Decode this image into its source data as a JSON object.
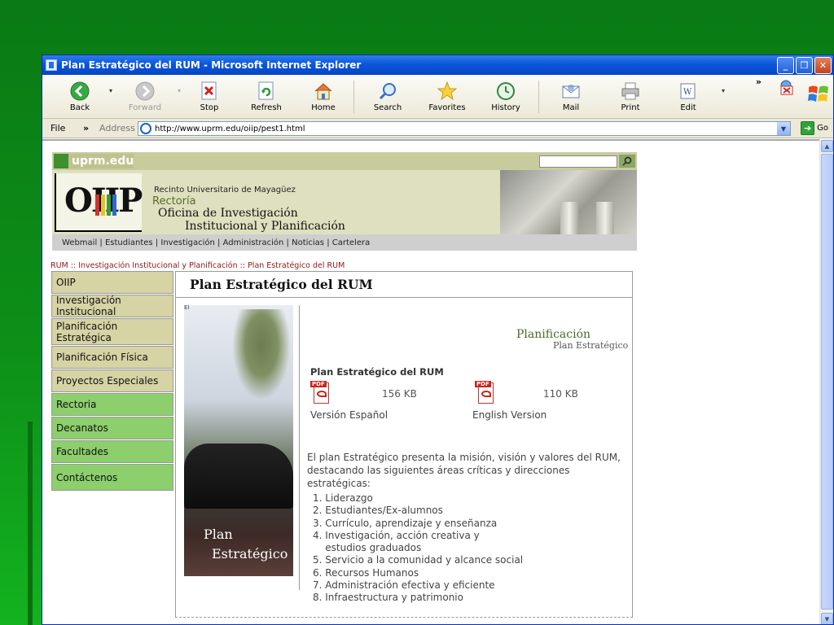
{
  "window": {
    "title": "Plan Estratégico del RUM - Microsoft Internet Explorer",
    "buttons": {
      "minimize": "_",
      "maximize": "❐",
      "close": "✕"
    }
  },
  "toolbar": {
    "back": "Back",
    "forward": "Forward",
    "stop": "Stop",
    "refresh": "Refresh",
    "home": "Home",
    "search": "Search",
    "favorites": "Favorites",
    "history": "History",
    "mail": "Mail",
    "print": "Print",
    "edit": "Edit",
    "more": "»"
  },
  "addressbar": {
    "file_menu": "File",
    "more": "»",
    "label": "Address",
    "url": "http://www.uprm.edu/oiip/pest1.html",
    "go": "Go"
  },
  "site": {
    "brand": "uprm.edu",
    "search_placeholder": "",
    "banner": {
      "logo": "OIIP",
      "line1": "Recinto Universitario de Mayagüez",
      "line2": "Rectoría",
      "line3": "Oficina de Investigación",
      "line4": "Institucional y Planificación"
    },
    "topnav": [
      "Webmail",
      "Estudiantes",
      "Investigación",
      "Administración",
      "Noticias",
      "Cartelera"
    ],
    "topnav_sep": " | ",
    "breadcrumb": "RUM :: Investigación Institucional y Planificación :: Plan Estratégico del RUM",
    "leftnav": [
      "OIIP",
      "Investigación Institucional",
      "Planificación Estratégica",
      "Planificación Física",
      "Proyectos Especiales",
      "Rectoria",
      "Decanatos",
      "Facultades",
      "Contáctenos"
    ],
    "content": {
      "title": "Plan Estratégico del RUM",
      "photo_text_1": "Plan",
      "photo_text_2": "Estratégico",
      "tiny_label": "El ",
      "planif_title": "Planificación",
      "planif_sub": "Plan Estratégico",
      "download_title": "Plan Estratégico del RUM",
      "downloads": [
        {
          "size": "156 KB",
          "label": "Versión Español"
        },
        {
          "size": "110 KB",
          "label": "English Version"
        }
      ],
      "intro": "El plan Estratégico presenta la misión, visión y valores del RUM, destacando las siguientes áreas críticas y direcciones estratégicas:",
      "list": [
        "1. Liderazgo",
        "2. Estudiantes/Ex-alumnos",
        "3. Currículo, aprendizaje y enseñanza",
        "4. Investigación, acción creativa y",
        "    estudios graduados",
        "5. Servicio a la comunidad y alcance social",
        "6. Recursos Humanos",
        "7. Administración efectiva y eficiente",
        "8. Infraestructura y patrimonio"
      ]
    }
  },
  "colors": {
    "slide_bg": "#0d8f18",
    "xp_titlebar": "#0b56d9",
    "nav_tan": "#d6d3a4",
    "nav_green": "#8ccf6c",
    "breadcrumb": "#8a1a1a",
    "planif_green": "#4b6a2a"
  }
}
